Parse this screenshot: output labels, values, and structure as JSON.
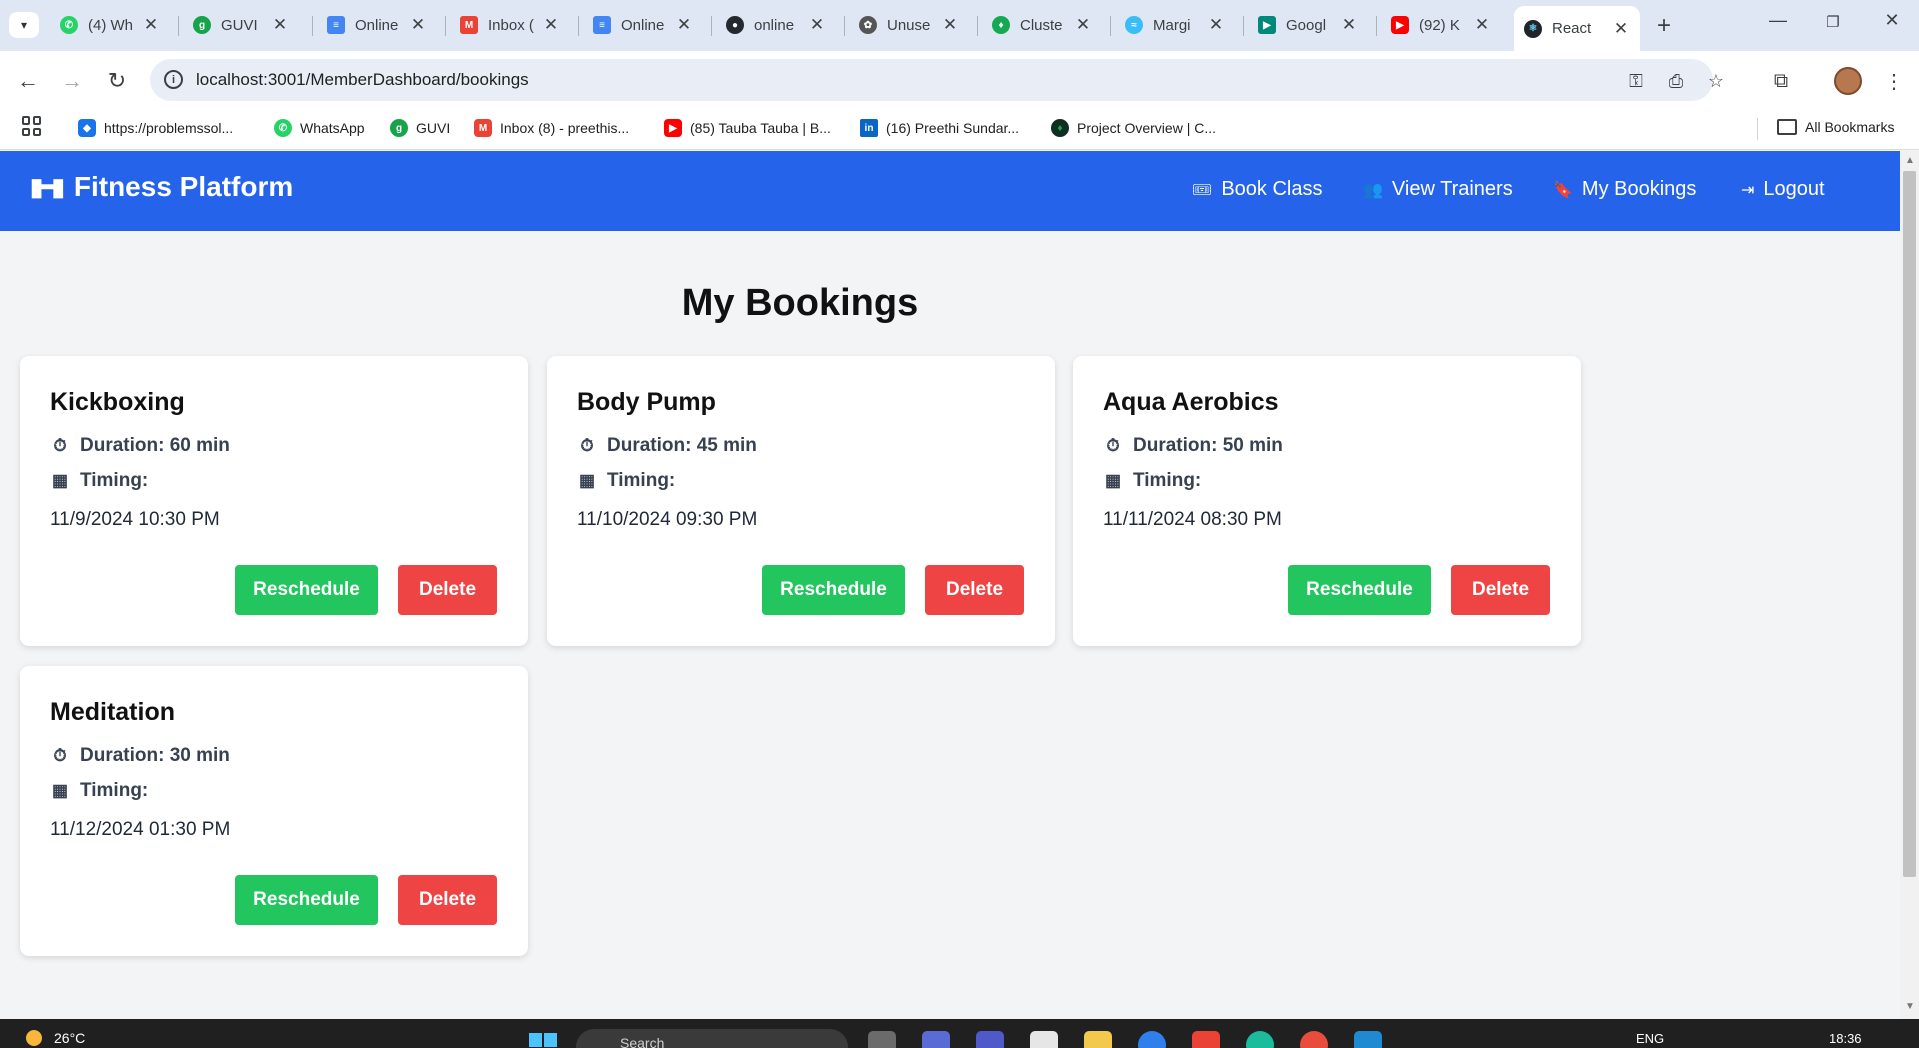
{
  "browser": {
    "tabs": [
      {
        "label": "(4) Wh",
        "favicon": "whatsapp-icon",
        "color": "#25d366"
      },
      {
        "label": "GUVI",
        "favicon": "guvi-icon",
        "color": "#16a34a"
      },
      {
        "label": "Online",
        "favicon": "google-docs-icon",
        "color": "#4285f4"
      },
      {
        "label": "Inbox (",
        "favicon": "gmail-icon",
        "color": "#ea4335"
      },
      {
        "label": "Online",
        "favicon": "google-docs-icon",
        "color": "#4285f4"
      },
      {
        "label": "online",
        "favicon": "github-icon",
        "color": "#24292f"
      },
      {
        "label": "Unuse",
        "favicon": "openai-icon",
        "color": "#555555"
      },
      {
        "label": "Cluste",
        "favicon": "mongodb-icon",
        "color": "#13aa52"
      },
      {
        "label": "Margi",
        "favicon": "tailwind-icon",
        "color": "#38bdf8"
      },
      {
        "label": "Googl",
        "favicon": "google-meet-icon",
        "color": "#00897b"
      },
      {
        "label": "(92) K",
        "favicon": "youtube-icon",
        "color": "#ff0000"
      },
      {
        "label": "React",
        "favicon": "react-icon",
        "color": "#149eca"
      }
    ],
    "address": "localhost:3001/MemberDashboard/bookings",
    "bookmarks": [
      {
        "label": "https://problemssol...",
        "icon": "problemsolving-icon",
        "color": "#1a73e8"
      },
      {
        "label": "WhatsApp",
        "icon": "whatsapp-icon",
        "color": "#25d366"
      },
      {
        "label": "GUVI",
        "icon": "guvi-icon",
        "color": "#16a34a"
      },
      {
        "label": "Inbox (8) - preethis...",
        "icon": "gmail-icon",
        "color": "#ea4335"
      },
      {
        "label": "(85) Tauba Tauba | B...",
        "icon": "youtube-icon",
        "color": "#ff0000"
      },
      {
        "label": "(16) Preethi Sundar...",
        "icon": "linkedin-icon",
        "color": "#0a66c2"
      },
      {
        "label": "Project Overview | C...",
        "icon": "mongodb-icon",
        "color": "#13aa52"
      }
    ],
    "all_bookmarks_label": "All Bookmarks"
  },
  "app": {
    "brand": "Fitness Platform",
    "header_color": "#2563eb",
    "nav": [
      {
        "label": "Book Class",
        "icon": "ticket-icon"
      },
      {
        "label": "View Trainers",
        "icon": "users-icon"
      },
      {
        "label": "My Bookings",
        "icon": "bookmark-icon"
      },
      {
        "label": "Logout",
        "icon": "logout-icon"
      }
    ]
  },
  "page": {
    "title": "My Bookings",
    "duration_prefix": "Duration: ",
    "timing_label": "Timing:",
    "reschedule_label": "Reschedule",
    "delete_label": "Delete",
    "reschedule_color": "#22c55e",
    "delete_color": "#ef4444"
  },
  "bookings": [
    {
      "name": "Kickboxing",
      "duration": "Duration: 60 min",
      "timing": "11/9/2024 10:30 PM"
    },
    {
      "name": "Body Pump",
      "duration": "Duration: 45 min",
      "timing": "11/10/2024 09:30 PM"
    },
    {
      "name": "Aqua Aerobics",
      "duration": "Duration: 50 min",
      "timing": "11/11/2024 08:30 PM"
    },
    {
      "name": "Meditation",
      "duration": "Duration: 30 min",
      "timing": "11/12/2024 01:30 PM"
    }
  ],
  "taskbar": {
    "weather": "26°C",
    "search_placeholder": "Search",
    "language": "ENG",
    "time": "18:36"
  }
}
